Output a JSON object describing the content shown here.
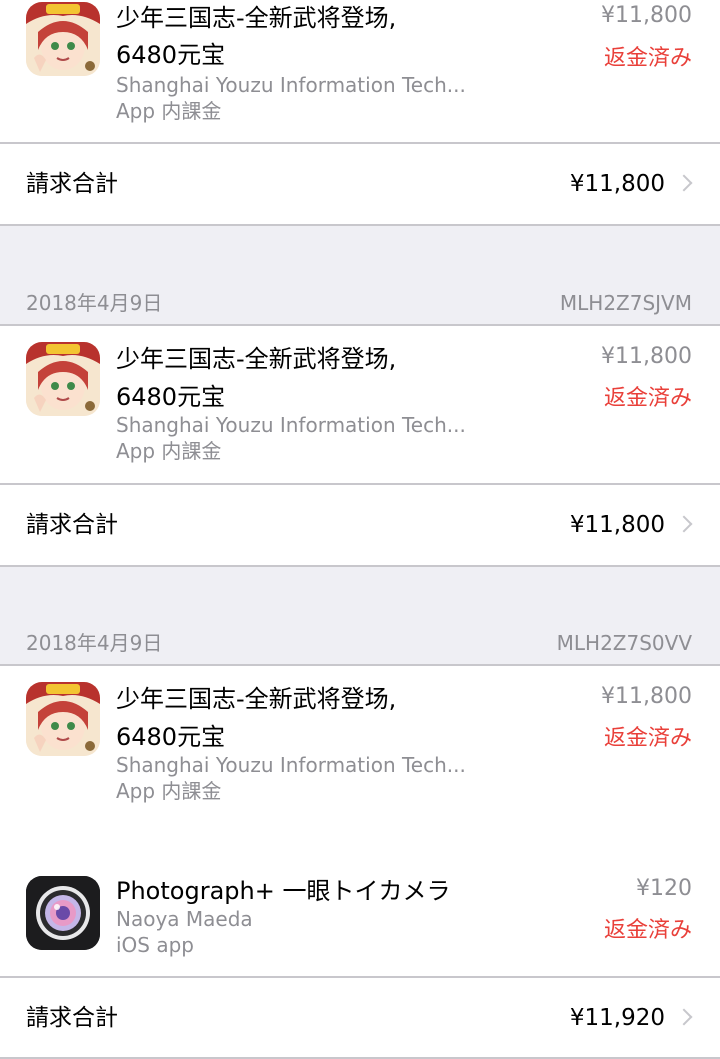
{
  "groups": [
    {
      "items": [
        {
          "title_line1": "少年三国志-全新武将登场,",
          "title_line2": "6480元宝",
          "developer": "Shanghai Youzu Information Tech...",
          "kind": "App 内課金",
          "price": "¥11,800",
          "status": "返金済み",
          "icon": "game-character-app-icon"
        }
      ],
      "total_label": "請求合計",
      "total_amount": "¥11,800"
    },
    {
      "date": "2018年4月9日",
      "order_id": "MLH2Z7SJVM",
      "items": [
        {
          "title_line1": "少年三国志-全新武将登场,",
          "title_line2": "6480元宝",
          "developer": "Shanghai Youzu Information Tech...",
          "kind": "App 内課金",
          "price": "¥11,800",
          "status": "返金済み",
          "icon": "game-character-app-icon"
        }
      ],
      "total_label": "請求合計",
      "total_amount": "¥11,800"
    },
    {
      "date": "2018年4月9日",
      "order_id": "MLH2Z7S0VV",
      "items": [
        {
          "title_line1": "少年三国志-全新武将登场,",
          "title_line2": "6480元宝",
          "developer": "Shanghai Youzu Information Tech...",
          "kind": "App 内課金",
          "price": "¥11,800",
          "status": "返金済み",
          "icon": "game-character-app-icon"
        },
        {
          "title_line1": "Photograph+ 一眼トイカメラ",
          "developer": "Naoya Maeda",
          "kind": "iOS app",
          "price": "¥120",
          "status": "返金済み",
          "icon": "camera-lens-app-icon"
        }
      ],
      "total_label": "請求合計",
      "total_amount": "¥11,920"
    }
  ],
  "colors": {
    "background": "#efeff4",
    "refund_status": "#e9403a",
    "secondary_text": "#8e8e93",
    "separator": "#c8c7cc"
  }
}
